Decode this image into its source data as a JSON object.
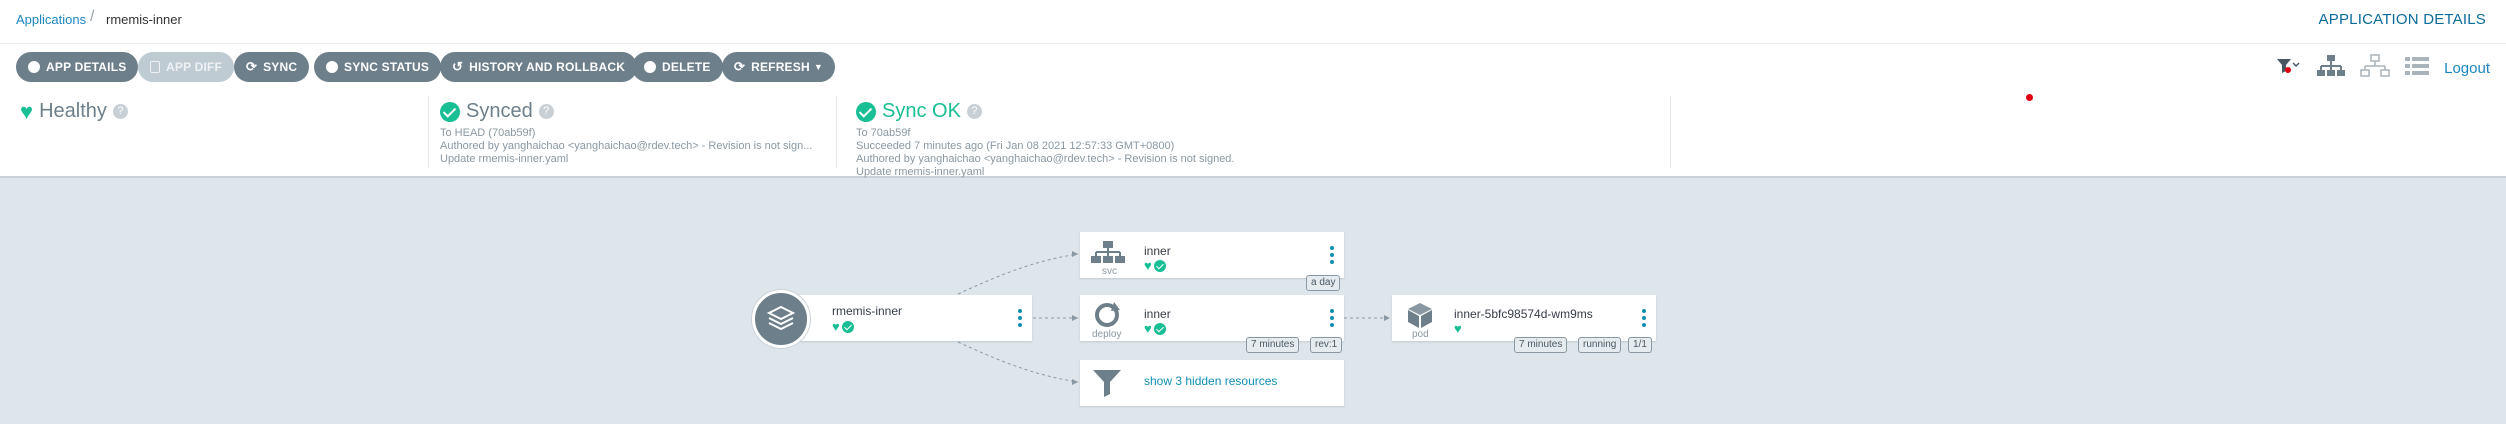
{
  "breadcrumb": {
    "root": "Applications",
    "separator": "/",
    "current": "rmemis-inner"
  },
  "header": {
    "app_details": "APPLICATION DETAILS"
  },
  "toolbar": {
    "app_details": "APP DETAILS",
    "app_diff": "APP DIFF",
    "sync": "SYNC",
    "sync_status": "SYNC STATUS",
    "history": "HISTORY AND ROLLBACK",
    "delete": "DELETE",
    "refresh": "REFRESH",
    "logout": "Logout"
  },
  "status": {
    "health": {
      "title": "Healthy",
      "help": "?"
    },
    "sync": {
      "title": "Synced",
      "help": "?",
      "to": "To HEAD (70ab59f)",
      "author": "Authored by yanghaichao <yanghaichao@rdev.tech> - Revision is not sign...",
      "message": "Update rmemis-inner.yaml"
    },
    "operation": {
      "title": "Sync OK",
      "help": "?",
      "to": "To 70ab59f",
      "time": "Succeeded 7 minutes ago (Fri Jan 08 2021 12:57:33 GMT+0800)",
      "author": "Authored by yanghaichao <yanghaichao@rdev.tech> - Revision is not signed.",
      "message": "Update rmemis-inner.yaml"
    }
  },
  "graph": {
    "app": {
      "name": "rmemis-inner"
    },
    "svc": {
      "name": "inner",
      "kind": "svc",
      "age": "a day"
    },
    "deploy": {
      "name": "inner",
      "kind": "deploy",
      "age": "7 minutes",
      "rev": "rev:1"
    },
    "hidden": {
      "label": "show 3 hidden resources"
    },
    "pod": {
      "name": "inner-5bfc98574d-wm9ms",
      "kind": "pod",
      "age": "7 minutes",
      "state": "running",
      "ready": "1/1"
    }
  },
  "colors": {
    "accent": "#0f8fb2",
    "healthy": "#18be94",
    "button": "#6d7f8b"
  }
}
